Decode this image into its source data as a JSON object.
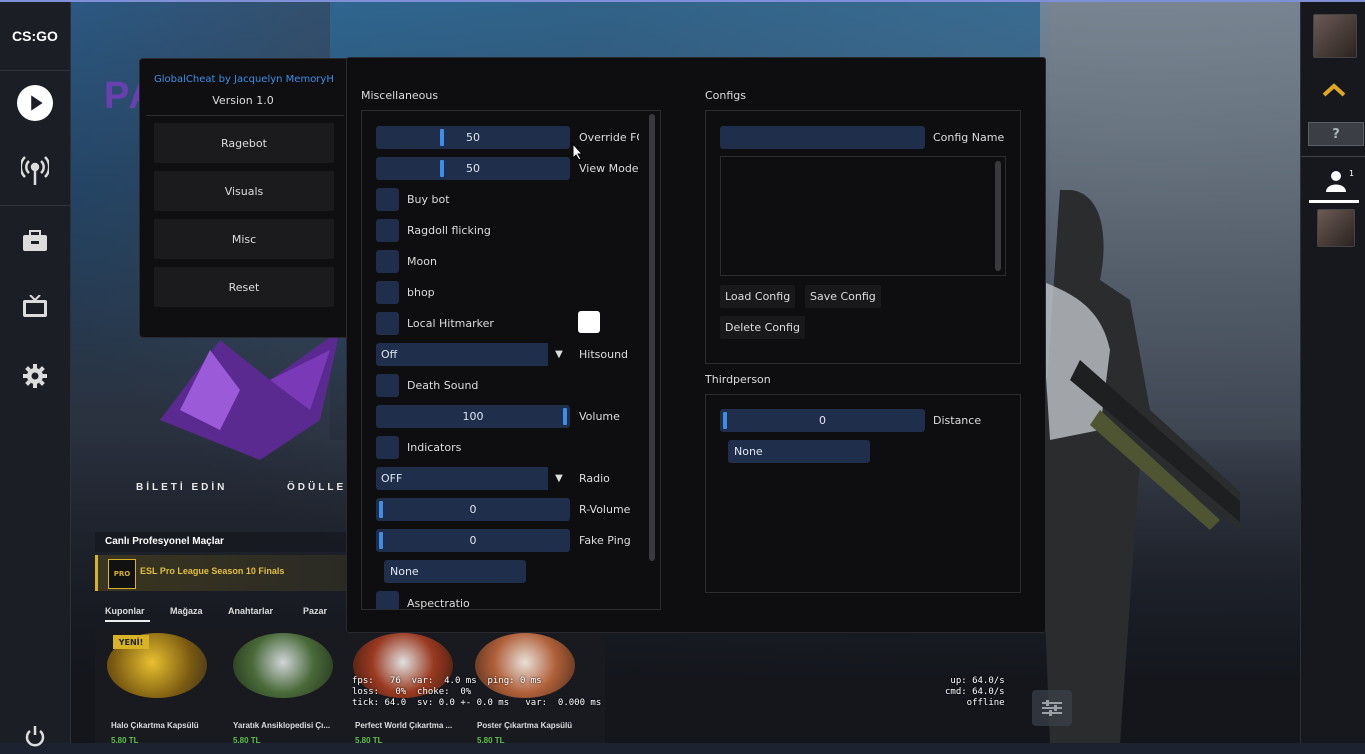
{
  "menu": {
    "title": "GlobalCheat by Jacquelyn MemoryH",
    "version": "Version 1.0",
    "tabs": [
      "Ragebot",
      "Visuals",
      "Misc",
      "Reset"
    ]
  },
  "misc": {
    "title": "Miscellaneous",
    "override_fov": {
      "value": "50",
      "label": "Override FOV",
      "fraction": 0.33
    },
    "view_model": {
      "value": "50",
      "label": "View Model",
      "fraction": 0.33
    },
    "checkboxes": {
      "buy_bot": "Buy bot",
      "ragdoll": "Ragdoll flicking",
      "moon": "Moon",
      "bhop": "bhop",
      "local_hitmarker": "Local Hitmarker",
      "death_sound": "Death Sound",
      "indicators": "Indicators",
      "aspect_ratio": "Aspectratio"
    },
    "hitsound": {
      "value": "Off",
      "label": "Hitsound"
    },
    "volume": {
      "value": "100",
      "label": "Volume",
      "fraction": 1.0
    },
    "radio": {
      "value": "OFF",
      "label": "Radio"
    },
    "r_volume": {
      "value": "0",
      "label": "R-Volume",
      "fraction": 0.0
    },
    "fake_ping": {
      "value": "0",
      "label": "Fake Ping",
      "fraction": 0.0
    },
    "none_field": "None"
  },
  "configs": {
    "title": "Configs",
    "name_label": "Config Name",
    "load": "Load Config",
    "save": "Save Config",
    "delete": "Delete Config"
  },
  "thirdperson": {
    "title": "Thirdperson",
    "distance": {
      "value": "0",
      "label": "Distance",
      "fraction": 0.0
    },
    "key": "None"
  },
  "game": {
    "logo": "CS:GO",
    "banner_left": "BİLETİ EDİN",
    "banner_right": "ÖDÜLLE",
    "live_matches": "Canlı Profesyonel Maçlar",
    "esl_logo": "PRO",
    "esl": "ESL Pro League Season 10 Finals",
    "shop_tabs": [
      "Kuponlar",
      "Mağaza",
      "Anahtarlar",
      "Pazar"
    ],
    "new_badge": "YENİ!",
    "capsules": [
      {
        "name": "Halo Çıkartma Kapsülü",
        "price": "5.80 TL"
      },
      {
        "name": "Yaratık Ansiklopedisi Çı...",
        "price": "5.80 TL"
      },
      {
        "name": "Perfect World Çıkartma ...",
        "price": "5.80 TL"
      },
      {
        "name": "Poster Çıkartma Kapsülü",
        "price": "5.80 TL"
      }
    ],
    "net_left": "fps:   76  var:  4.0 ms  ping: 0 ms\nloss:   0%  choke:  0%\ntick: 64.0  sv: 0.0 +- 0.0 ms   var:  0.000 ms",
    "net_right": "up: 64.0/s\ncmd: 64.0/s\n offline",
    "friends_count": "1"
  },
  "colors": {
    "accent": "#3d8ee6",
    "widget": "#1f2e4a",
    "window": "#0e0e10"
  }
}
